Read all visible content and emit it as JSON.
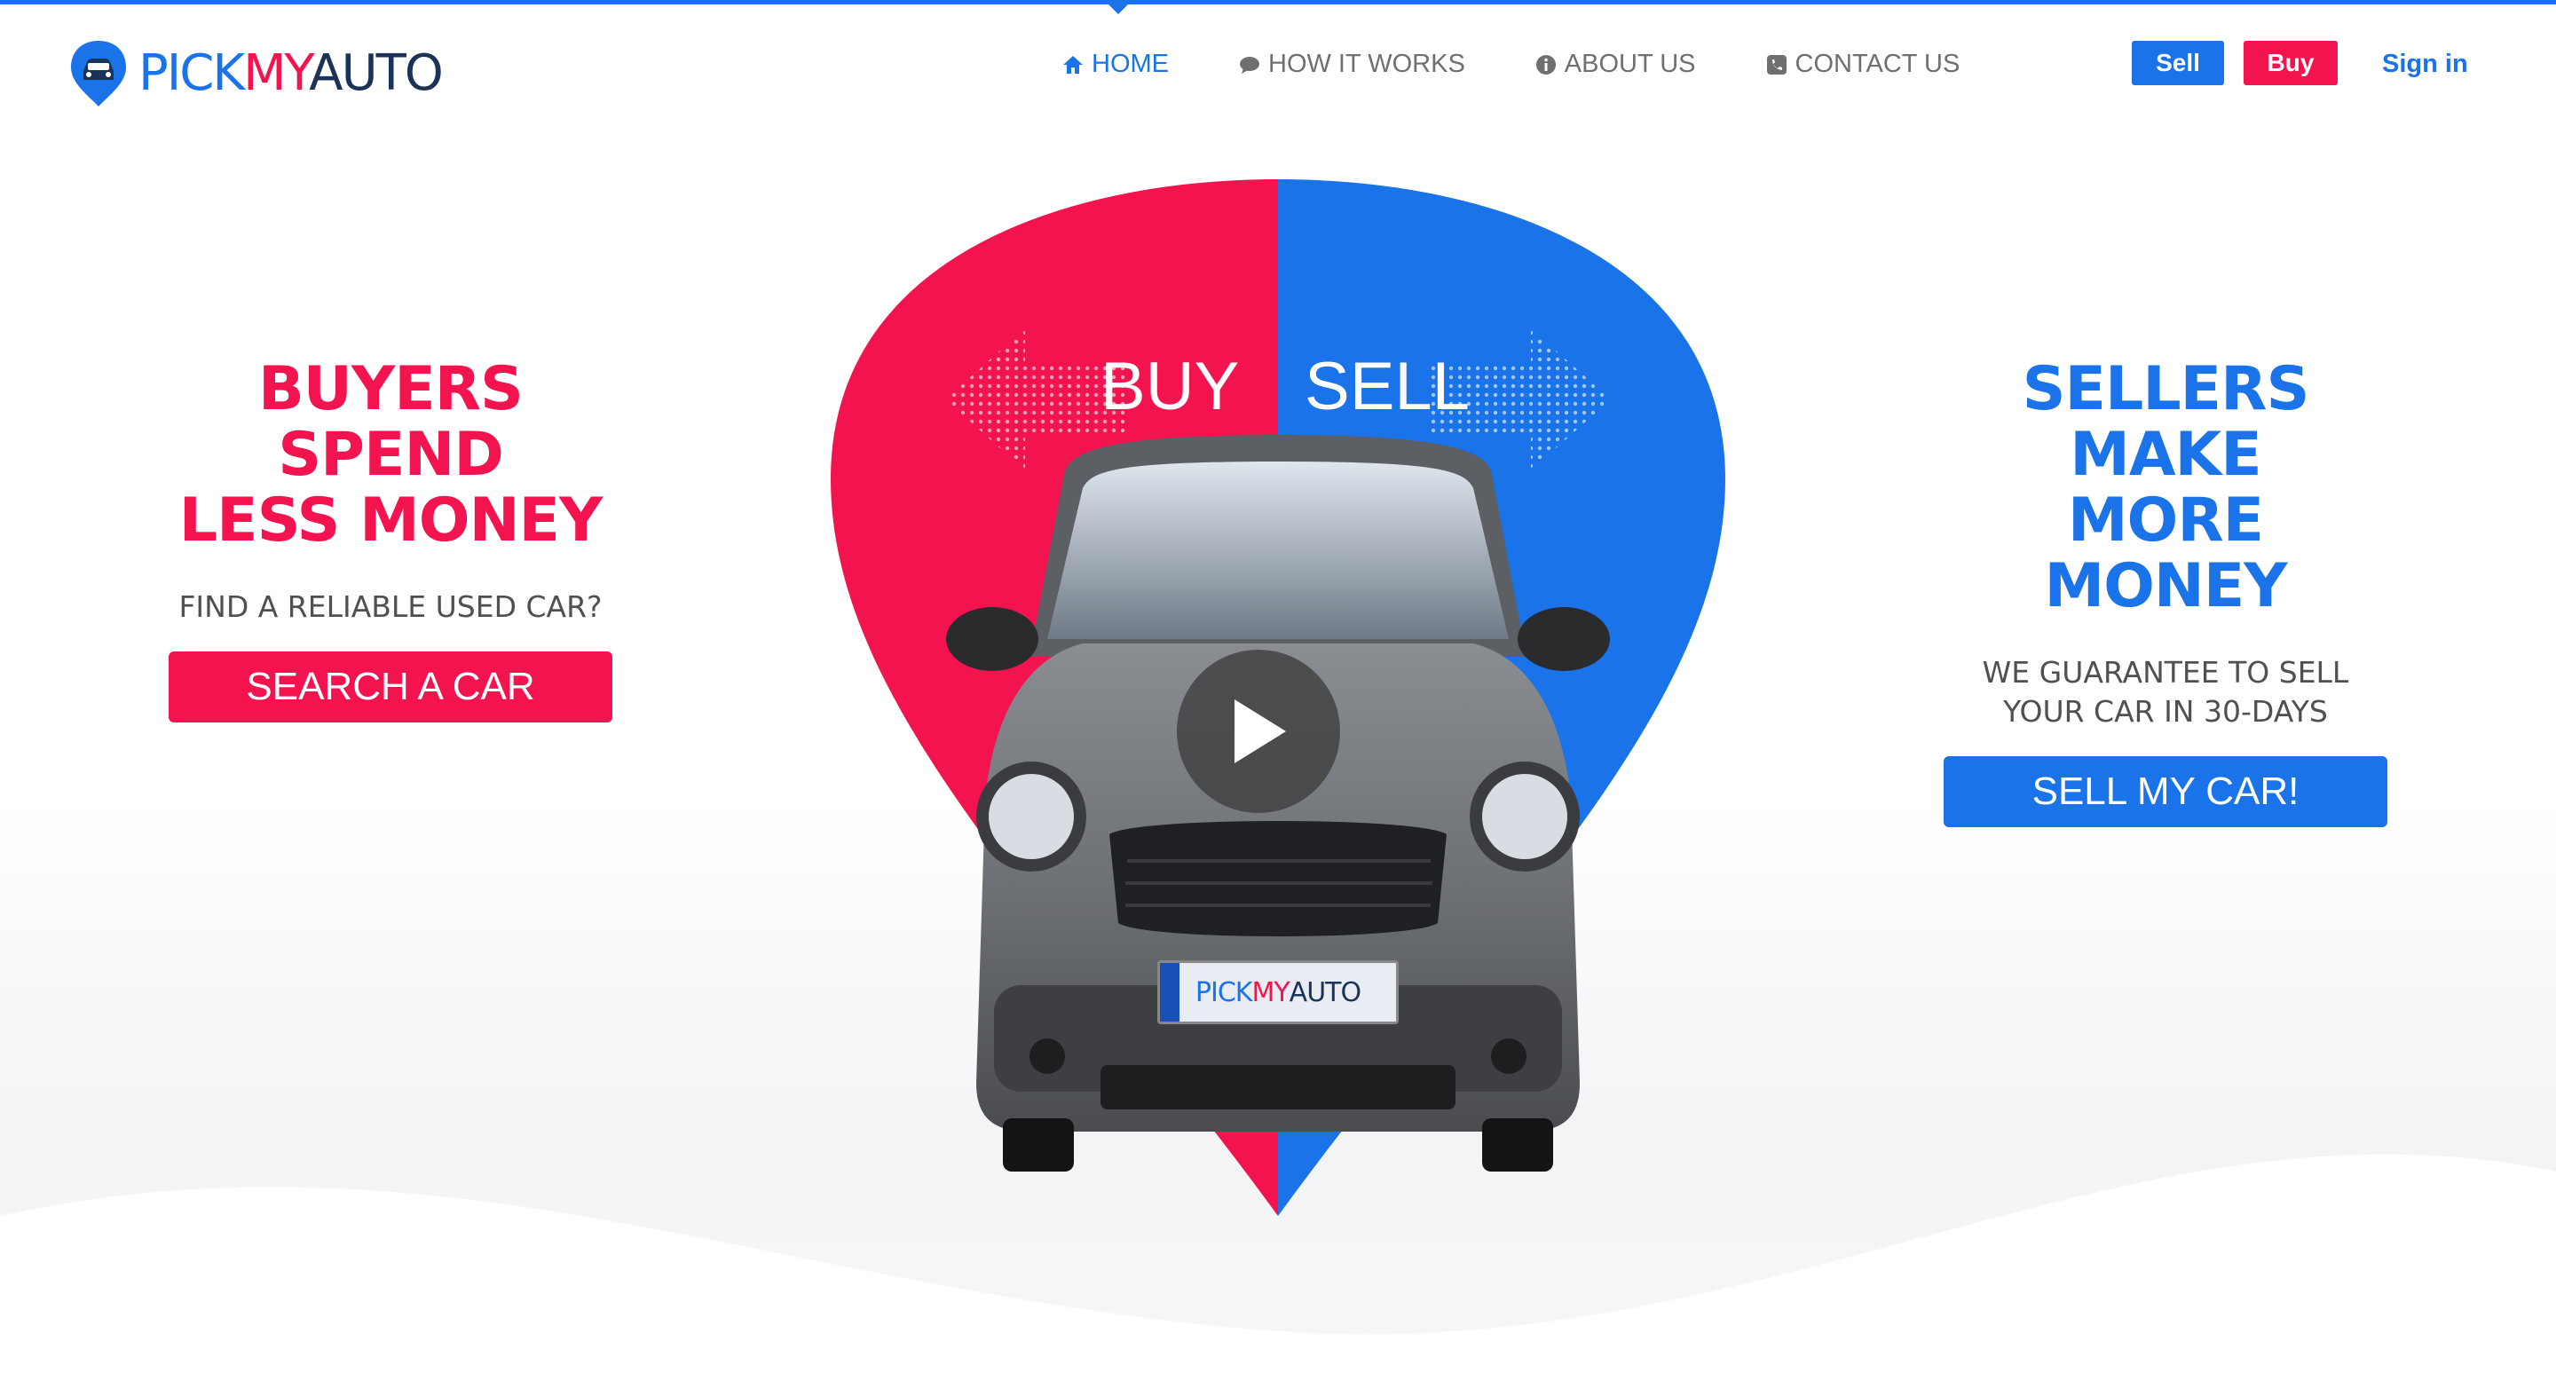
{
  "brand": {
    "pick": "PICK",
    "my": "MY",
    "auto": "AUTO",
    "plate_pick": "PICK",
    "plate_my": "MY",
    "plate_auto": "AUTO"
  },
  "nav": {
    "items": [
      {
        "label": "HOME",
        "icon": "home-icon",
        "active": true
      },
      {
        "label": "HOW IT WORKS",
        "icon": "chat-icon",
        "active": false
      },
      {
        "label": "ABOUT US",
        "icon": "info-icon",
        "active": false
      },
      {
        "label": "CONTACT US",
        "icon": "phone-icon",
        "active": false
      }
    ]
  },
  "header_actions": {
    "sell": "Sell",
    "buy": "Buy",
    "signin": "Sign in"
  },
  "hero": {
    "buy_label": "BUY",
    "sell_label": "SELL",
    "left": {
      "headline_1": "BUYERS SPEND",
      "headline_2": "LESS MONEY",
      "subline": "FIND A RELIABLE USED CAR?",
      "cta": "SEARCH A CAR"
    },
    "right": {
      "headline_1": "SELLERS MAKE",
      "headline_2": "MORE MONEY",
      "subline_1": "WE GUARANTEE TO SELL",
      "subline_2": "YOUR CAR IN 30-DAYS",
      "cta": "SELL MY CAR!"
    }
  },
  "colors": {
    "brand_blue": "#1a73e8",
    "brand_red": "#f2134f",
    "brand_navy": "#1b3358"
  }
}
